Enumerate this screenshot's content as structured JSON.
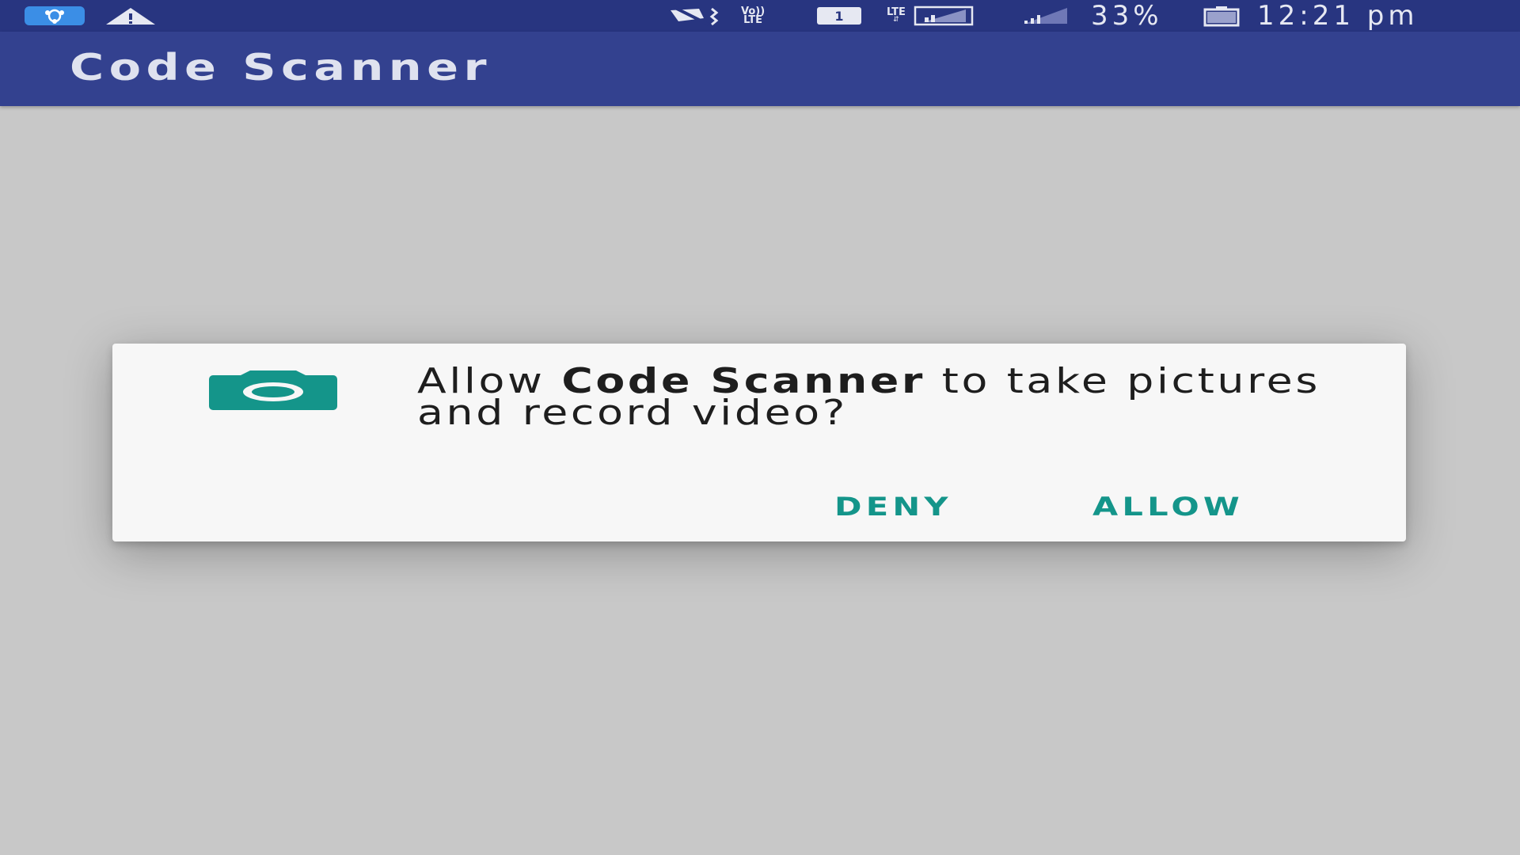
{
  "status_bar": {
    "notification_icons": [
      "share-it-icon",
      "warning-icon"
    ],
    "system_icons": [
      "vibrate-icon",
      "volte-icon",
      "sim-1-icon",
      "lte-signal-icon",
      "signal-icon",
      "battery-icon"
    ],
    "volte_label_top": "Vo))",
    "volte_label_bottom": "LTE",
    "sim_label": "1",
    "lte_label": "LTE",
    "battery_percent": "33%",
    "time": "12:21 pm"
  },
  "app_bar": {
    "title": "Code Scanner"
  },
  "permission_dialog": {
    "icon": "camera-icon",
    "message_prefix": "Allow ",
    "app_name": "Code Scanner",
    "message_suffix": " to take pictures and record video?",
    "deny_label": "DENY",
    "allow_label": "ALLOW"
  },
  "colors": {
    "status_bar": "#283580",
    "app_bar": "#33418f",
    "background": "#c8c8c8",
    "accent": "#14958a",
    "dialog": "#f7f7f7"
  }
}
